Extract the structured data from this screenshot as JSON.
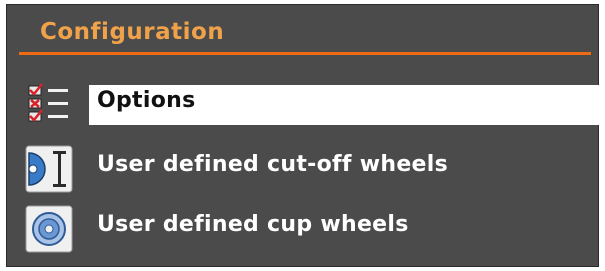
{
  "header": {
    "title": "Configuration"
  },
  "colors": {
    "panel_background": "#4b4b4b",
    "title_text": "#f0a24a",
    "title_rule": "#ee6a13",
    "selected_background": "#ffffff",
    "selected_text": "#111111",
    "item_text": "#ffffff"
  },
  "menu": {
    "selected_index": 0,
    "items": [
      {
        "label": "Options",
        "icon": "checklist-icon"
      },
      {
        "label": "User defined cut-off wheels",
        "icon": "cut-off-wheel-icon"
      },
      {
        "label": "User defined cup wheels",
        "icon": "cup-wheel-icon"
      }
    ]
  }
}
